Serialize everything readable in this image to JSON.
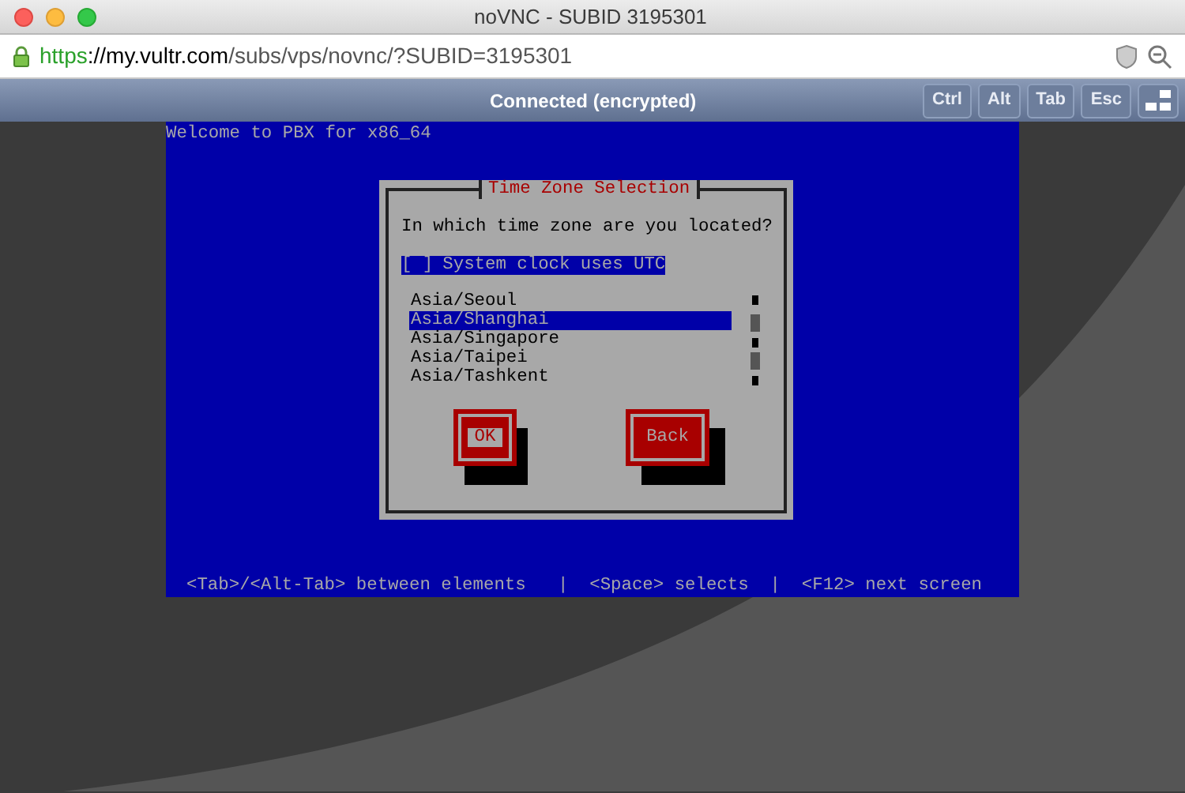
{
  "window": {
    "title": "noVNC - SUBID 3195301"
  },
  "address_bar": {
    "scheme": "https",
    "host": "://my.vultr.com",
    "path": "/subs/vps/novnc/?SUBID=3195301"
  },
  "vnc_bar": {
    "status": "Connected (encrypted)",
    "keys": [
      "Ctrl",
      "Alt",
      "Tab",
      "Esc"
    ]
  },
  "console": {
    "header": "Welcome to PBX for x86_64",
    "dialog": {
      "title": "Time Zone Selection",
      "question": "In which time zone are you located?",
      "checkbox": {
        "mark": "[ ]",
        "label": "System clock uses UTC",
        "checked": false,
        "focused": true
      },
      "timezones": [
        {
          "label": "Asia/Seoul",
          "selected": false
        },
        {
          "label": "Asia/Shanghai",
          "selected": true
        },
        {
          "label": "Asia/Singapore",
          "selected": false
        },
        {
          "label": "Asia/Taipei",
          "selected": false
        },
        {
          "label": "Asia/Tashkent",
          "selected": false
        }
      ],
      "buttons": [
        {
          "label": "OK",
          "focused": true
        },
        {
          "label": "Back",
          "focused": false
        }
      ]
    },
    "help_line": "<Tab>/<Alt-Tab> between elements   |  <Space> selects  |  <F12> next screen"
  }
}
